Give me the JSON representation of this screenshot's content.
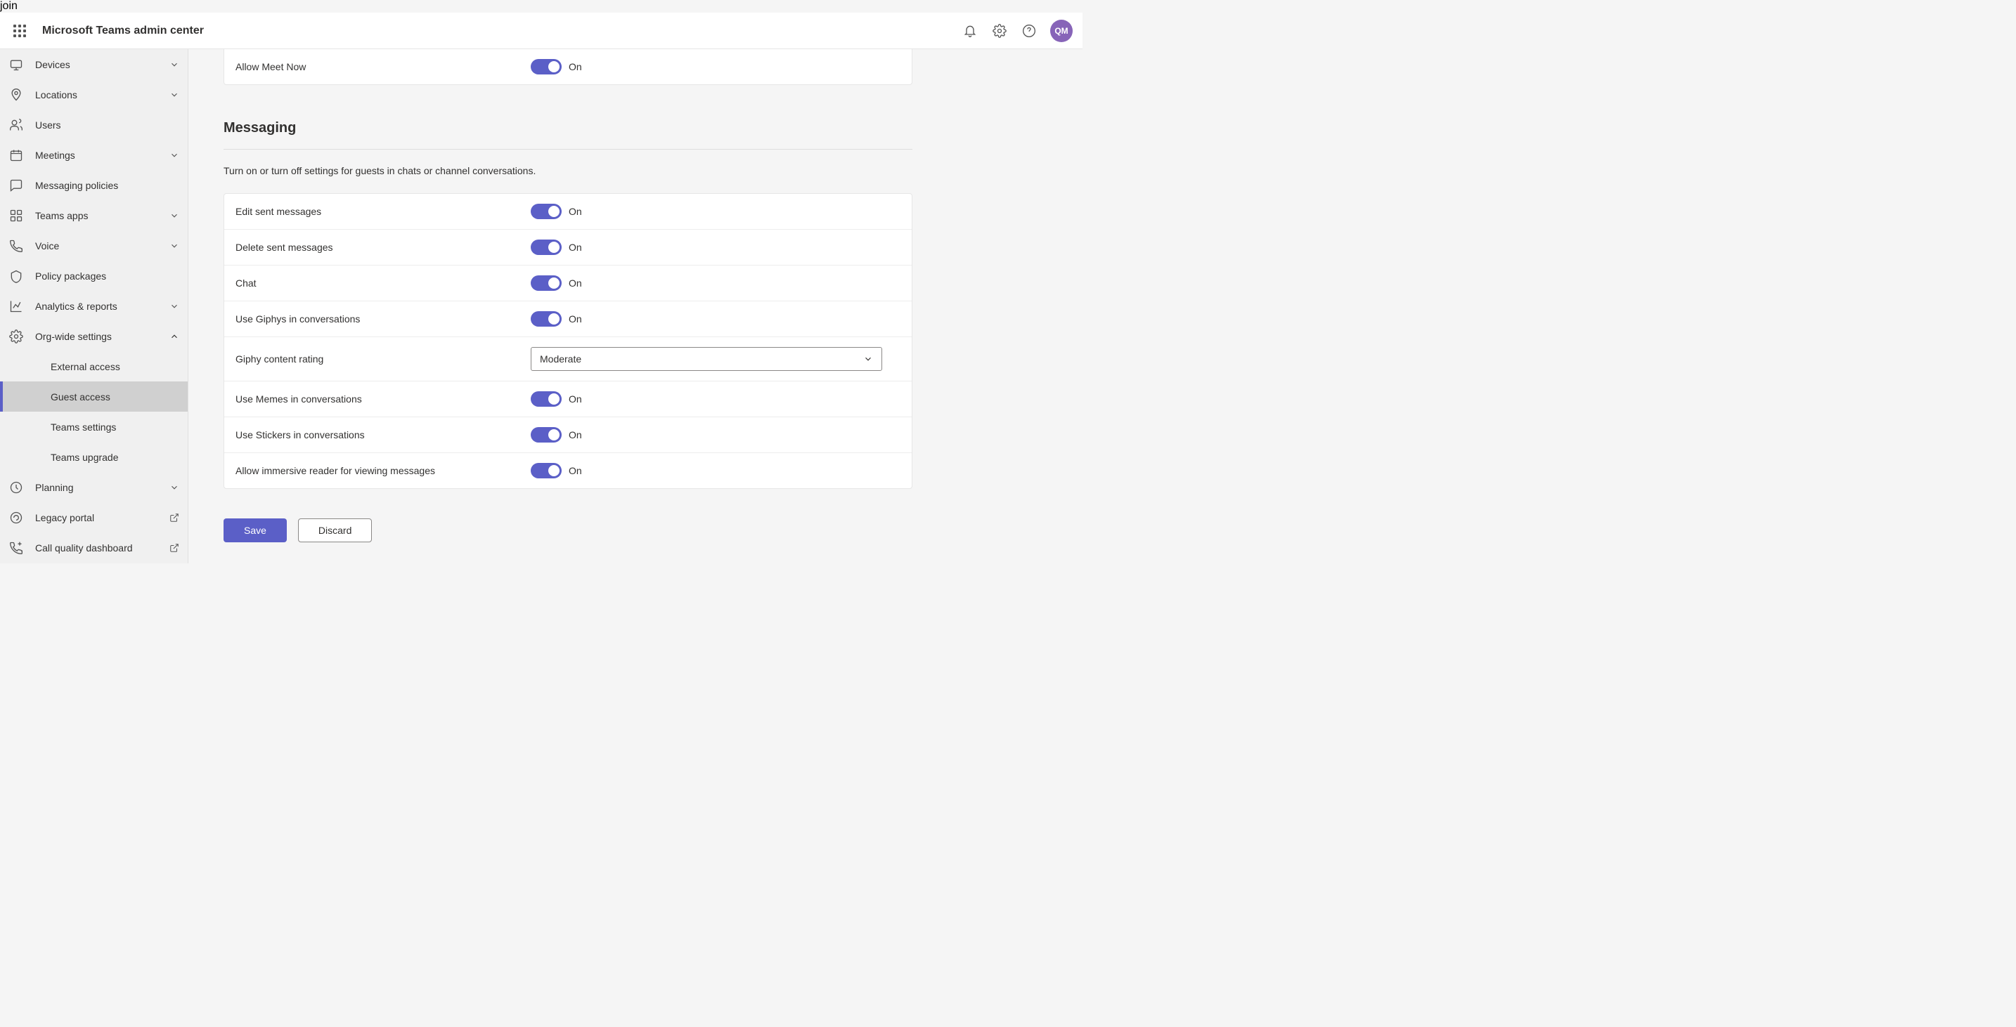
{
  "header": {
    "title": "Microsoft Teams admin center",
    "avatar_initials": "QM"
  },
  "sidebar": {
    "items": [
      {
        "icon": "devices",
        "label": "Devices",
        "expandable": true
      },
      {
        "icon": "locations",
        "label": "Locations",
        "expandable": true
      },
      {
        "icon": "users",
        "label": "Users",
        "expandable": false
      },
      {
        "icon": "meetings",
        "label": "Meetings",
        "expandable": true
      },
      {
        "icon": "messaging",
        "label": "Messaging policies",
        "expandable": false
      },
      {
        "icon": "apps",
        "label": "Teams apps",
        "expandable": true
      },
      {
        "icon": "voice",
        "label": "Voice",
        "expandable": true
      },
      {
        "icon": "policy",
        "label": "Policy packages",
        "expandable": false
      },
      {
        "icon": "analytics",
        "label": "Analytics & reports",
        "expandable": true
      },
      {
        "icon": "org",
        "label": "Org-wide settings",
        "expandable": true,
        "expanded": true
      }
    ],
    "org_sub": [
      {
        "label": "External access"
      },
      {
        "label": "Guest access",
        "active": true
      },
      {
        "label": "Teams settings"
      },
      {
        "label": "Teams upgrade"
      }
    ],
    "items_after": [
      {
        "icon": "planning",
        "label": "Planning",
        "expandable": true
      },
      {
        "icon": "legacy",
        "label": "Legacy portal",
        "external": true
      },
      {
        "icon": "call-quality",
        "label": "Call quality dashboard",
        "external": true
      }
    ]
  },
  "top_card": {
    "rows": [
      {
        "label": "Allow Meet Now",
        "state": "On"
      }
    ]
  },
  "section": {
    "title": "Messaging",
    "description": "Turn on or turn off settings for guests in chats or channel conversations."
  },
  "messaging_card": {
    "rows": [
      {
        "label": "Edit sent messages",
        "type": "toggle",
        "state": "On"
      },
      {
        "label": "Delete sent messages",
        "type": "toggle",
        "state": "On"
      },
      {
        "label": "Chat",
        "type": "toggle",
        "state": "On"
      },
      {
        "label": "Use Giphys in conversations",
        "type": "toggle",
        "state": "On"
      },
      {
        "label": "Giphy content rating",
        "type": "select",
        "value": "Moderate"
      },
      {
        "label": "Use Memes in conversations",
        "type": "toggle",
        "state": "On"
      },
      {
        "label": "Use Stickers in conversations",
        "type": "toggle",
        "state": "On"
      },
      {
        "label": "Allow immersive reader for viewing messages",
        "type": "toggle",
        "state": "On"
      }
    ]
  },
  "buttons": {
    "save": "Save",
    "discard": "Discard"
  }
}
